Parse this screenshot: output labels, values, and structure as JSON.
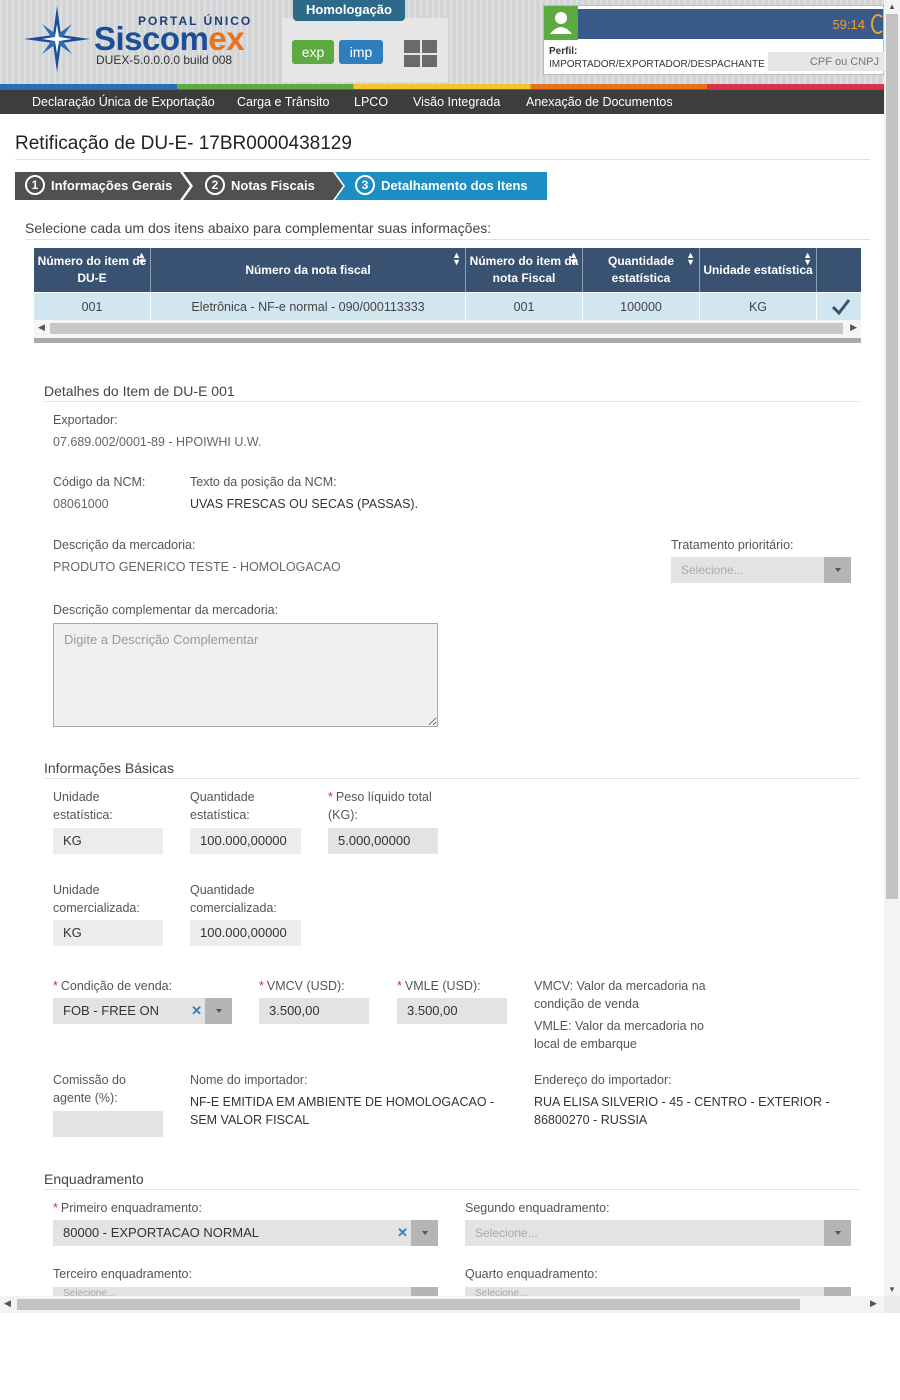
{
  "header": {
    "portal_label": "PORTAL ÚNICO",
    "logo_main": "Siscom",
    "logo_accent": "ex",
    "build": "DUEX-5.0.0.0.0  build 008",
    "environment": "Homologação",
    "exp_label": "exp",
    "imp_label": "imp",
    "timer": "59:14",
    "perfil_label": "Perfil:",
    "perfil_value": "IMPORTADOR/EXPORTADOR/DESPACHANTE",
    "cpf_placeholder": "CPF ou CNPJ",
    "icons": [
      "star-logo-icon",
      "grid-apps-icon",
      "user-avatar-icon",
      "power-icon"
    ]
  },
  "nav": {
    "items": [
      "Declaração Única de Exportação",
      "Carga e Trânsito",
      "LPCO",
      "Visão Integrada",
      "Anexação de Documentos"
    ]
  },
  "page": {
    "title": "Retificação de DU-E- 17BR0000438129",
    "steps": [
      {
        "num": "1",
        "label": "Informações Gerais"
      },
      {
        "num": "2",
        "label": "Notas Fiscais"
      },
      {
        "num": "3",
        "label": "Detalhamento dos Itens"
      }
    ],
    "instruction": "Selecione cada um dos itens abaixo para complementar suas informações:"
  },
  "table": {
    "headers": [
      "Número do item de DU-E",
      "Número da nota fiscal",
      "Número do item da nota Fiscal",
      "Quantidade estatística",
      "Unidade estatística"
    ],
    "rows": [
      {
        "item_due": "001",
        "nota_fiscal": "Eletrônica - NF-e normal - 090/000113333",
        "item_nota": "001",
        "quantidade": "100000",
        "unidade": "KG"
      }
    ]
  },
  "detalhes": {
    "section_title": "Detalhes do Item de DU-E 001",
    "exportador_label": "Exportador:",
    "exportador_value": "07.689.002/0001-89 - HPOIWHI U.W.",
    "ncm_label": "Código da NCM:",
    "ncm_value": "08061000",
    "ncm_texto_label": "Texto da posição da NCM:",
    "ncm_texto_value": "UVAS FRESCAS OU SECAS (PASSAS).",
    "descricao_label": "Descrição da mercadoria:",
    "descricao_value": "PRODUTO GENERICO TESTE - HOMOLOGACAO",
    "tratamento_label": "Tratamento prioritário:",
    "tratamento_placeholder": "Selecione...",
    "desc_comp_label": "Descrição complementar da mercadoria:",
    "desc_comp_placeholder": "Digite a Descrição Complementar"
  },
  "basicas": {
    "section_title": "Informações Básicas",
    "un_estatistica_label": "Unidade estatística:",
    "un_estatistica_value": "KG",
    "qt_estatistica_label": "Quantidade estatística:",
    "qt_estatistica_value": "100.000,00000",
    "peso_label": "Peso líquido total (KG):",
    "peso_value": "5.000,00000",
    "un_comercial_label": "Unidade comercializada:",
    "un_comercial_value": "KG",
    "qt_comercial_label": "Quantidade comercializada:",
    "qt_comercial_value": "100.000,00000",
    "condicao_label": "Condição de venda:",
    "condicao_value": "FOB - FREE ON",
    "vmcv_label": "VMCV (USD):",
    "vmcv_value": "3.500,00",
    "vmle_label": "VMLE (USD):",
    "vmle_value": "3.500,00",
    "vmcv_help": "VMCV: Valor da mercadoria na condição de venda",
    "vmle_help": "VMLE: Valor da mercadoria no local de embarque",
    "comissao_label": "Comissão do agente (%):",
    "comissao_value": "",
    "importador_label": "Nome do importador:",
    "importador_value": "NF-E EMITIDA EM AMBIENTE DE HOMOLOGACAO - SEM VALOR FISCAL",
    "endereco_label": "Endereço do importador:",
    "endereco_value": "RUA ELISA SILVERIO - 45 - CENTRO - EXTERIOR - 86800270 - RUSSIA"
  },
  "enquadramento": {
    "section_title": "Enquadramento",
    "primeiro_label": "Primeiro enquadramento:",
    "primeiro_value": "80000 - EXPORTACAO NORMAL",
    "segundo_label": "Segundo enquadramento:",
    "segundo_placeholder": "Selecione...",
    "terceiro_label": "Terceiro enquadramento:",
    "quarto_label": "Quarto enquadramento:",
    "placeholder": "Selecione..."
  },
  "colors": {
    "nav_bg": "#3d3d3d",
    "table_head": "#3a5272",
    "row_selected": "#d1e6ef",
    "step_active": "#1c8ec4",
    "step_inactive": "#505050",
    "env_badge": "#2d6a8a",
    "exp_green": "#5daa40",
    "imp_blue": "#2f7fbf",
    "required": "#c0392b"
  }
}
